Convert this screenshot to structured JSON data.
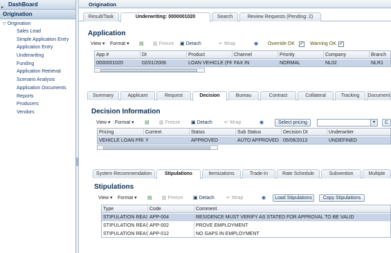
{
  "sidebar": {
    "dashboard": "DashBoard",
    "origination": "Origination",
    "tree_root": "Origination",
    "items": [
      "Sales Lead",
      "Simple Application Entry",
      "Application Entry",
      "Underwriting",
      "Funding",
      "Application Retrieval",
      "Scenario Analysis",
      "Application Documents",
      "Reports",
      "Producers",
      "Vendors"
    ]
  },
  "header": {
    "title": "Origination"
  },
  "top_tabs": [
    "Result/Task",
    "Underwriting: 0000001020",
    "Search",
    "Review Requests (Pending: 2)"
  ],
  "application": {
    "title": "Application",
    "toolbar": {
      "view": "View",
      "format": "Format",
      "freeze": "Freeze",
      "detach": "Detach",
      "wrap": "Wrap",
      "override_ok": "Override OK",
      "warning_ok": "Warning OK"
    },
    "columns": [
      "App #",
      "Dt",
      "Product",
      "Channel",
      "Priority",
      "Company",
      "Branch"
    ],
    "rows": [
      [
        "0000001020",
        "02/01/2006",
        "LOAN VEHICLE (FR)",
        "FAX IN",
        "NORMAL",
        "NL02",
        "NLR1"
      ]
    ]
  },
  "detail_tabs": [
    "Summary",
    "Applicant",
    "Request",
    "Decision",
    "Bureau",
    "Contract",
    "Collateral",
    "Tracking",
    "Document"
  ],
  "decision": {
    "title": "Decision Information",
    "toolbar": {
      "view": "View",
      "format": "Format",
      "freeze": "Freeze",
      "detach": "Detach",
      "wrap": "Wrap",
      "select_pricing": "Select pricing"
    },
    "columns": [
      "Pricing",
      "Current",
      "Status",
      "Sub Status",
      "Decision Dt",
      "Underwriter"
    ],
    "rows": [
      [
        "VEHICLE LOAN PRICI",
        "Y",
        "APPROVED",
        "AUTO APPROVED",
        "05/06/2013",
        "UNDEFINED"
      ]
    ]
  },
  "sub_tabs": [
    "System Recommendation",
    "Stipulations",
    "Itemizations",
    "Trade-In",
    "Rate Schedule",
    "Subvention",
    "Multiple"
  ],
  "stipulations": {
    "title": "Stipulations",
    "toolbar": {
      "view": "View",
      "format": "Format",
      "freeze": "Freeze",
      "detach": "Detach",
      "wrap": "Wrap",
      "load": "Load Stipulations",
      "copy": "Copy Stipulations"
    },
    "columns": [
      "Type",
      "Code",
      "Comment"
    ],
    "rows": [
      [
        "STIPULATION REASO",
        "APP-004",
        "RESIDENCE MUST VERIFY AS STATED FOR APPROVAL TO BE VALID"
      ],
      [
        "STIPULATION REASO",
        "APP-002",
        "PROVE EMPLOYMENT"
      ],
      [
        "STIPULATION REASO",
        "APP-012",
        "NO GAPS IN EMPLOYMENT"
      ]
    ]
  },
  "colors": {
    "accent": "#0b2d55",
    "selected_row": "#c7d3e6",
    "border": "#9fb4c9"
  }
}
